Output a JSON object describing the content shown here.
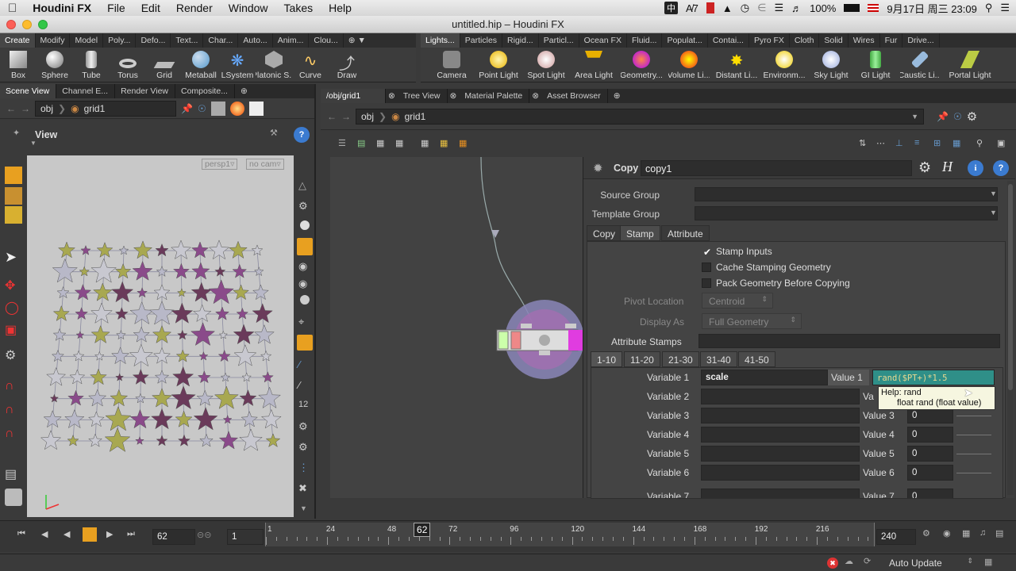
{
  "menubar": {
    "app": "Houdini FX",
    "items": [
      "File",
      "Edit",
      "Render",
      "Window",
      "Takes",
      "Help"
    ],
    "status_7": "7",
    "battery": "100%",
    "clock": "9月17日 周三 23:09"
  },
  "window": {
    "title": "untitled.hip – Houdini FX"
  },
  "shelf_left": {
    "tabs": [
      "Create",
      "Modify",
      "Model",
      "Poly...",
      "Defo...",
      "Text...",
      "Char...",
      "Auto...",
      "Anim...",
      "Clou..."
    ],
    "tools": [
      "Box",
      "Sphere",
      "Tube",
      "Torus",
      "Grid",
      "Metaball",
      "LSystem",
      "Platonic S...",
      "Curve",
      "Draw"
    ]
  },
  "shelf_right": {
    "tabs": [
      "Lights...",
      "Particles",
      "Rigid...",
      "Particl...",
      "Ocean FX",
      "Fluid...",
      "Populat...",
      "Contai...",
      "Pyro FX",
      "Cloth",
      "Solid",
      "Wires",
      "Fur",
      "Drive..."
    ],
    "tools": [
      "Camera",
      "Point Light",
      "Spot Light",
      "Area Light",
      "Geometry...",
      "Volume Li...",
      "Distant Li...",
      "Environm...",
      "Sky Light",
      "GI Light",
      "Caustic Li...",
      "Portal Light"
    ]
  },
  "left_pane": {
    "tabs": [
      "Scene View",
      "Channel E...",
      "Render View",
      "Composite..."
    ],
    "path_root": "obj",
    "path_node": "grid1",
    "view_label": "View",
    "camera": "persp1",
    "cam_select": "no cam"
  },
  "right_pane": {
    "tabs": [
      "/obj/grid1",
      "Tree View",
      "Material Palette",
      "Asset Browser"
    ],
    "path_root": "obj",
    "path_node": "grid1"
  },
  "params": {
    "node_type": "Copy",
    "node_name": "copy1",
    "source_group_label": "Source Group",
    "template_group_label": "Template Group",
    "tabs": [
      "Copy",
      "Stamp",
      "Attribute"
    ],
    "stamp_inputs": "Stamp Inputs",
    "cache_stamping": "Cache Stamping Geometry",
    "pack_geometry": "Pack Geometry Before Copying",
    "pivot_location_label": "Pivot Location",
    "pivot_location_value": "Centroid",
    "display_as_label": "Display As",
    "display_as_value": "Full Geometry",
    "attribute_stamps_label": "Attribute Stamps",
    "range_tabs": [
      "1-10",
      "11-20",
      "21-30",
      "31-40",
      "41-50"
    ],
    "variables": [
      {
        "label": "Variable 1",
        "name": "scale",
        "value_label": "Value 1",
        "value": "rand($PT+)*1.5"
      },
      {
        "label": "Variable 2",
        "name": "",
        "value_label": "Va",
        "value": ""
      },
      {
        "label": "Variable 3",
        "name": "",
        "value_label": "Value 3",
        "value": "0"
      },
      {
        "label": "Variable 4",
        "name": "",
        "value_label": "Value 4",
        "value": "0"
      },
      {
        "label": "Variable 5",
        "name": "",
        "value_label": "Value 5",
        "value": "0"
      },
      {
        "label": "Variable 6",
        "name": "",
        "value_label": "Value 6",
        "value": "0"
      },
      {
        "label": "Variable 7",
        "name": "",
        "value_label": "Value 7",
        "value": "0"
      }
    ],
    "tooltip_line1": "Help: rand",
    "tooltip_line2": "float rand (float value)"
  },
  "timeline": {
    "current_frame": "62",
    "start_frame": "1",
    "end_frame": "240",
    "ticks": [
      "1",
      "24",
      "48",
      "62",
      "72",
      "96",
      "120",
      "144",
      "168",
      "192",
      "216"
    ]
  },
  "status": {
    "update_mode": "Auto Update"
  },
  "colors": {
    "accent_orange": "#f0a030",
    "value_field_teal": "#2f8f88",
    "node_magenta": "#e03ce0"
  }
}
